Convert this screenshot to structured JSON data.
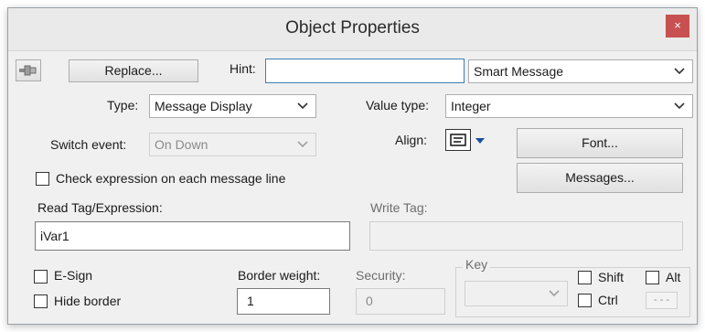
{
  "window": {
    "title": "Object Properties",
    "close_glyph": "×"
  },
  "toolbar": {
    "pin_icon": "pin-icon",
    "replace_label": "Replace...",
    "hint_label": "Hint:",
    "hint_value": "",
    "message_type": "Smart Message"
  },
  "type": {
    "label": "Type:",
    "value": "Message Display"
  },
  "value_type": {
    "label": "Value type:",
    "value": "Integer"
  },
  "switch_event": {
    "label": "Switch event:",
    "value": "On Down"
  },
  "align": {
    "label": "Align:",
    "icon": "align-left-icon"
  },
  "font_button": "Font...",
  "messages_button": "Messages...",
  "check_expression_label": "Check expression on each message line",
  "read_tag": {
    "label": "Read Tag/Expression:",
    "value": "iVar1"
  },
  "write_tag": {
    "label": "Write Tag:",
    "value": ""
  },
  "esign_label": "E-Sign",
  "hide_border_label": "Hide border",
  "border_weight": {
    "label": "Border weight:",
    "value": "1"
  },
  "security": {
    "label": "Security:",
    "value": "0"
  },
  "key": {
    "label": "Key",
    "value": "",
    "shift_label": "Shift",
    "alt_label": "Alt",
    "ctrl_label": "Ctrl",
    "browse_label": "- - -"
  },
  "colors": {
    "close_bg": "#c75050",
    "focus_border": "#3c7fb1",
    "window_bg": "#f0f0f0"
  }
}
